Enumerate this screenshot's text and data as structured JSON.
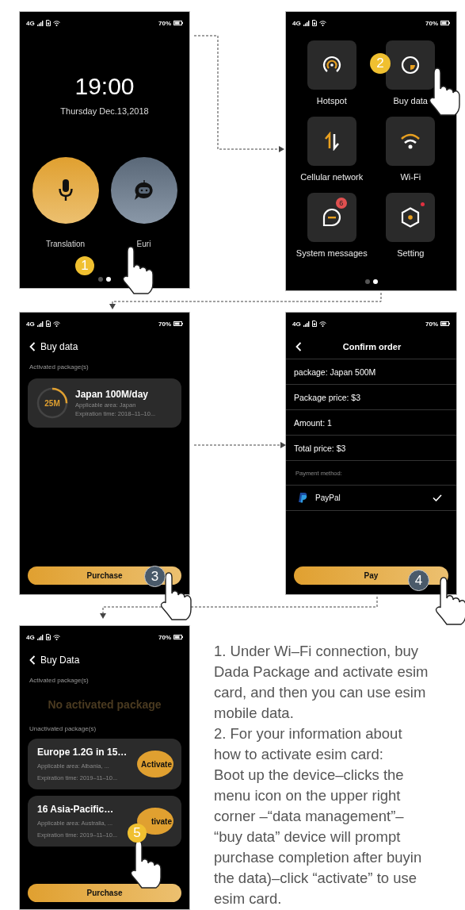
{
  "screens": [
    {
      "kind": "home",
      "status_bar": {
        "network": "4G",
        "battery": "70%"
      },
      "time": "19:00",
      "date": "Thursday Dec.13,2018",
      "apps": [
        {
          "label": "Translation"
        },
        {
          "label": "Euri"
        }
      ],
      "page_dots": [
        {
          "selected": false
        },
        {
          "selected": true
        }
      ],
      "step": "1"
    },
    {
      "kind": "menu",
      "status_bar": {
        "network": "4G",
        "battery": "70%"
      },
      "tiles": [
        {
          "label": "Hotspot",
          "notification_dot": false
        },
        {
          "label": "Buy data",
          "notification_dot": false
        },
        {
          "label": "Cellular network",
          "notification_dot": false
        },
        {
          "label": "Wi-Fi",
          "notification_dot": false
        },
        {
          "label": "System messages",
          "badge": "6",
          "notification_dot": false
        },
        {
          "label": "Setting",
          "notification_dot": true
        }
      ],
      "page_dots": [
        {
          "selected": false
        },
        {
          "selected": true
        }
      ],
      "step": "2"
    },
    {
      "kind": "packages",
      "status_bar": {
        "network": "4G",
        "battery": "70%"
      },
      "title": "Buy data",
      "activated_label": "Activated package(s)",
      "activated": [
        {
          "name": "Japan 100M/day",
          "remaining": "25M",
          "level": 0.25,
          "area": "Applicable area: Japan",
          "expiration": "Expiration time: 2018–11–10..."
        }
      ],
      "button": "Purchase",
      "step": "3"
    },
    {
      "kind": "order",
      "status_bar": {
        "network": "4G",
        "battery": "70%"
      },
      "title": "Confirm order",
      "rows": [
        "package: Japan 500M",
        "Package price: $3",
        "Amount: 1",
        "Total price: $3"
      ],
      "payment_label": "Payment method:",
      "payments": [
        {
          "name": "PayPal",
          "selected": true
        }
      ],
      "button": "Pay",
      "step": "4"
    },
    {
      "kind": "packages",
      "status_bar": {
        "network": "4G",
        "battery": "70%"
      },
      "title": "Buy Data",
      "activated_label": "Activated package(s)",
      "empty_text": "No activated package",
      "unactivated_label": "Unactivated package(s)",
      "unactivated": [
        {
          "name": "Europe 1.2G in 15…",
          "area": "Applicable area: Albania, ...",
          "expiration": "Expiration time: 2019–11–10...",
          "action": "Activate"
        },
        {
          "name": "16 Asia-Pacific…",
          "area": "Applicable area: Australia, ...",
          "expiration": "Expiration time: 2019–11–10...",
          "action": "tivate"
        }
      ],
      "button": "Purchase",
      "step": "5"
    }
  ],
  "instructions": [
    "1.  Under Wi–Fi connection, buy",
    "Dada Package and activate esim",
    "card, and then you can use esim",
    "mobile data.",
    "2.  For your information about",
    "how to activate esim card:",
    "Boot up the device–clicks the",
    "menu icon on the upper right",
    "corner –“data management”–",
    "“buy data” device will prompt",
    "purchase completion after buyin",
    "the data)–click “activate” to use",
    "esim card."
  ]
}
